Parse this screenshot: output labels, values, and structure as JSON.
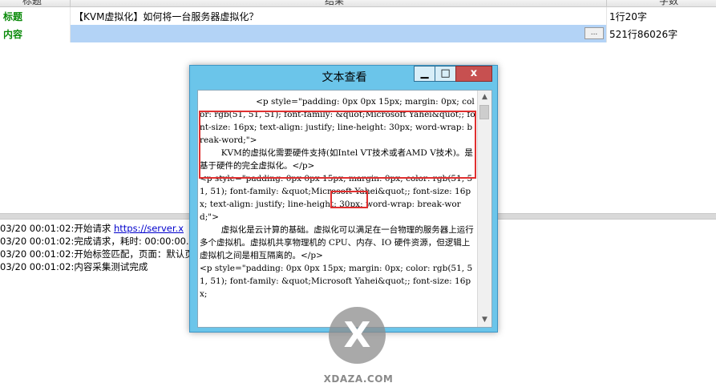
{
  "table": {
    "header": {
      "col1": "标题",
      "col2": "结果",
      "col3": "字数"
    },
    "rows": [
      {
        "label": "标题",
        "value": "【KVM虚拟化】如何将一台服务器虚拟化？",
        "count": "1行20字"
      },
      {
        "label": "内容",
        "value": "",
        "ellipsis": "...",
        "count": "521行86026字"
      }
    ]
  },
  "log": [
    {
      "text": "03/20 00:01:02:开始请求 ",
      "link": "https://server.x"
    },
    {
      "text": "03/20 00:01:02:完成请求，耗时: 00:00:00.",
      "link": ""
    },
    {
      "text": "03/20 00:01:02:开始标签匹配，页面：默认页",
      "link": ""
    },
    {
      "text": "03/20 00:01:02:内容采集测试完成",
      "link": ""
    }
  ],
  "dialog": {
    "title": "文本查看",
    "minimize": "▁",
    "maximize": "□",
    "close": "x",
    "text": "                     <p style=\"padding: 0px 0px 15px; margin: 0px; color: rgb(51, 51, 51); font-family: &quot;Microsoft Yahei&quot;; font-size: 16px; text-align: justify; line-height: 30px; word-wrap: break-word;\">\n        KVM的虚拟化需要硬件支持(如Intel VT技术或者AMD V技术)。是基于硬件的完全虚拟化。</p>\n<p style=\"padding: 0px 0px 15px; margin: 0px; color: rgb(51, 51, 51); font-family: &quot;Microsoft Yahei&quot;; font-size: 16px; text-align: justify; line-height: 30px; word-wrap: break-word;\">\n        虚拟化是云计算的基础。虚拟化可以满足在一台物理的服务器上运行多个虚拟机。虚拟机共享物理机的 CPU、内存、IO 硬件资源，但逻辑上虚拟机之间是相互隔离的。</p>\n<p style=\"padding: 0px 0px 15px; margin: 0px; color: rgb(51, 51, 51); font-family: &quot;Microsoft Yahei&quot;; font-size: 16px;"
  },
  "watermark": {
    "symbol": "X",
    "site": "XDAZA.COM"
  }
}
